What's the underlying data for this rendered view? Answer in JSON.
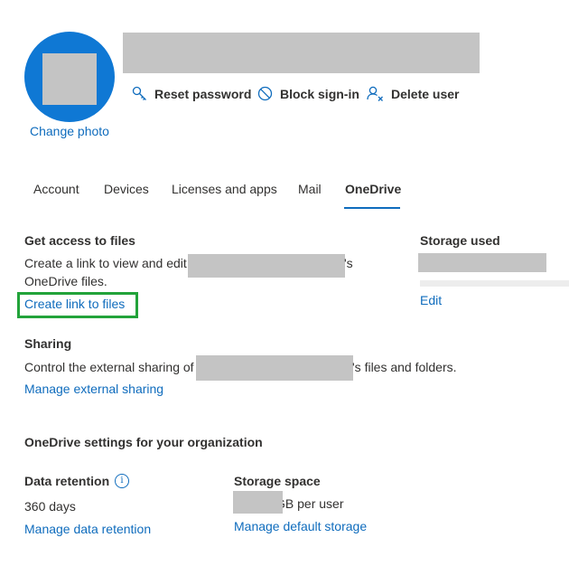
{
  "profile": {
    "change_photo_label": "Change photo"
  },
  "actions": {
    "reset_password": "Reset password",
    "block_signin": "Block sign-in",
    "delete_user": "Delete user"
  },
  "tabs": [
    {
      "label": "Account"
    },
    {
      "label": "Devices"
    },
    {
      "label": "Licenses and apps"
    },
    {
      "label": "Mail"
    },
    {
      "label": "OneDrive",
      "active": true
    }
  ],
  "files": {
    "heading": "Get access to files",
    "desc_prefix": "Create a link to view and edit",
    "desc_suffix": "'s",
    "desc_line2": "OneDrive files.",
    "link": "Create link to files"
  },
  "storage_used": {
    "heading": "Storage used",
    "edit_link": "Edit"
  },
  "sharing": {
    "heading": "Sharing",
    "desc_prefix": "Control the external sharing of",
    "desc_suffix": "'s files and folders.",
    "link": "Manage external sharing"
  },
  "org_settings": {
    "heading": "OneDrive settings for your organization",
    "retention_label": "Data retention",
    "retention_value": "360 days",
    "retention_link": "Manage data retention",
    "storage_label": "Storage space",
    "storage_value_suffix": "GB per user",
    "storage_link": "Manage default storage"
  },
  "colors": {
    "accent": "#0f6cbd",
    "avatar_bg": "#0f78d4",
    "highlight_box": "#22a33a",
    "redaction": "#c4c4c4"
  },
  "icons": {
    "reset_password": "key-icon",
    "block_signin": "block-icon",
    "delete_user": "delete-user-icon",
    "info": "info-icon"
  }
}
